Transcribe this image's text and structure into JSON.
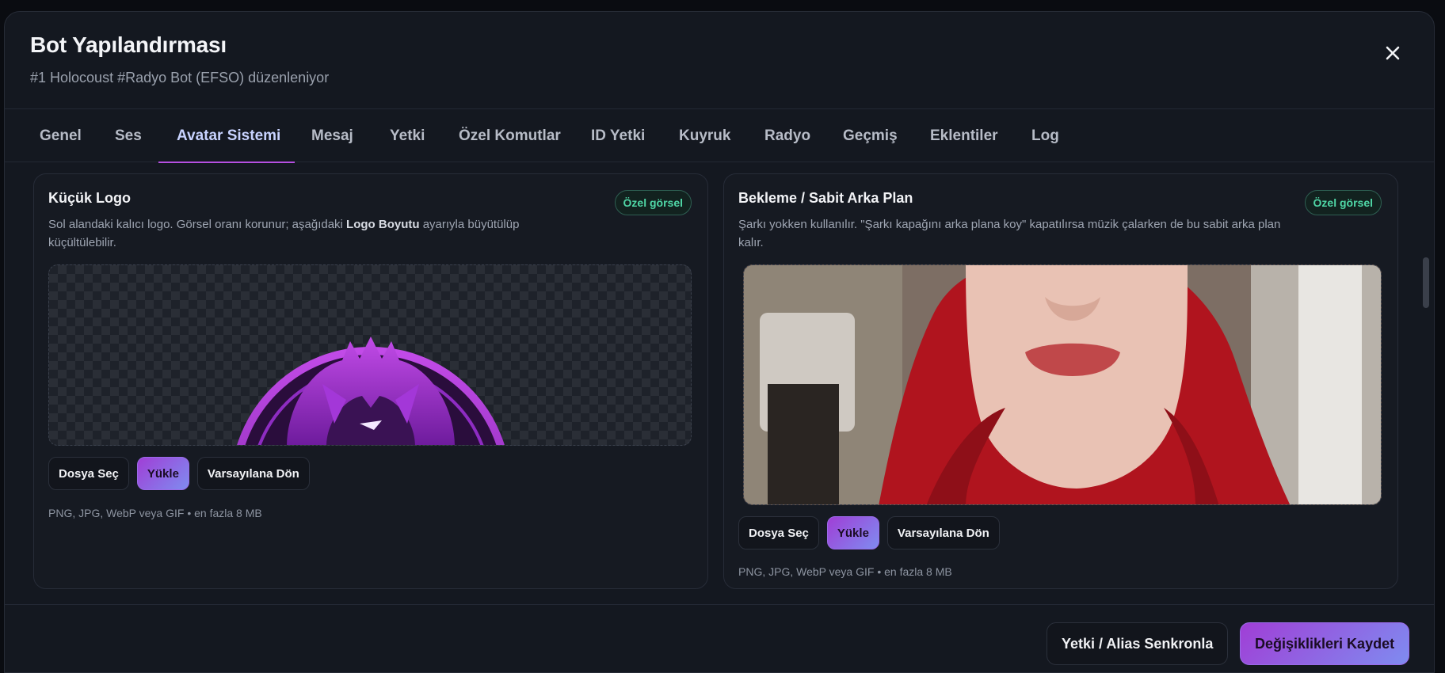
{
  "modal": {
    "title": "Bot Yapılandırması",
    "subtitle": "#1 Holocoust #Radyo Bot (EFSO) düzenleniyor",
    "close_icon": "close-icon"
  },
  "tabs": [
    {
      "label": "Genel"
    },
    {
      "label": "Ses"
    },
    {
      "label": "Avatar Sistemi",
      "active": true
    },
    {
      "label": "Mesaj"
    },
    {
      "label": "Yetki"
    },
    {
      "label": "Özel Komutlar"
    },
    {
      "label": "ID Yetki"
    },
    {
      "label": "Kuyruk"
    },
    {
      "label": "Radyo"
    },
    {
      "label": "Geçmiş"
    },
    {
      "label": "Eklentiler"
    },
    {
      "label": "Log"
    }
  ],
  "cards": {
    "logo": {
      "title": "Küçük Logo",
      "badge": "Özel görsel",
      "desc_before": "Sol alandaki kalıcı logo. Görsel oranı korunur; aşağıdaki ",
      "desc_bold": "Logo Boyutu",
      "desc_after": " ayarıyla büyütülüp küçültülebilir.",
      "buttons": {
        "choose": "Dosya Seç",
        "upload": "Yükle",
        "reset": "Varsayılana Dön"
      },
      "hint": "PNG, JPG, WebP veya GIF • en fazla 8 MB"
    },
    "background": {
      "title": "Bekleme / Sabit Arka Plan",
      "badge": "Özel görsel",
      "desc": "Şarkı yokken kullanılır. \"Şarkı kapağını arka plana koy\" kapatılırsa müzik çalarken de bu sabit arka plan kalır.",
      "buttons": {
        "choose": "Dosya Seç",
        "upload": "Yükle",
        "reset": "Varsayılana Dön"
      },
      "hint": "PNG, JPG, WebP veya GIF • en fazla 8 MB"
    }
  },
  "footer": {
    "sync_label": "Yetki / Alias Senkronla",
    "save_label": "Değişiklikleri Kaydet"
  },
  "colors": {
    "accent": "#b54fe0",
    "tab_active": "#c8d3ff",
    "badge": "#4fd6a6"
  }
}
